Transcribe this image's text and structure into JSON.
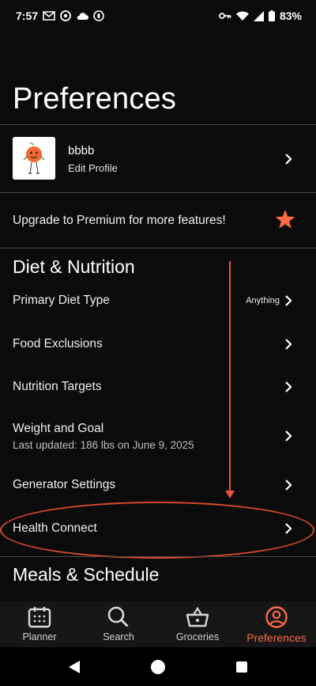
{
  "status": {
    "time": "7:57",
    "battery": "83%"
  },
  "page": {
    "title": "Preferences"
  },
  "profile": {
    "name": "bbbb",
    "edit_label": "Edit Profile"
  },
  "premium": {
    "text": "Upgrade to Premium for more features!"
  },
  "diet_section": {
    "title": "Diet & Nutrition",
    "items": [
      {
        "label": "Primary Diet Type",
        "value": "Anything"
      },
      {
        "label": "Food Exclusions"
      },
      {
        "label": "Nutrition Targets"
      },
      {
        "label": "Weight and Goal",
        "sub": "Last updated:  186 lbs on June 9, 2025"
      },
      {
        "label": "Generator Settings"
      },
      {
        "label": "Health Connect"
      }
    ]
  },
  "meals_section": {
    "title": "Meals & Schedule"
  },
  "bottom_nav": {
    "items": [
      {
        "label": "Planner",
        "icon": "calendar-icon"
      },
      {
        "label": "Search",
        "icon": "search-icon"
      },
      {
        "label": "Groceries",
        "icon": "basket-icon"
      },
      {
        "label": "Preferences",
        "icon": "user-circle-icon",
        "active": true
      }
    ]
  },
  "colors": {
    "accent": "#ff6b45",
    "annotation": "#e8553a",
    "background": "#0b0b0b"
  }
}
